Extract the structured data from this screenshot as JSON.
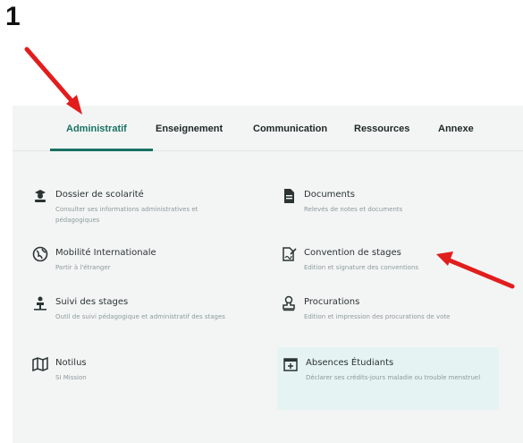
{
  "annotation": {
    "step_number": "1",
    "arrow_color": "#e21d1d"
  },
  "tabs": [
    {
      "label": "Administratif",
      "active": true
    },
    {
      "label": "Enseignement",
      "active": false
    },
    {
      "label": "Communication",
      "active": false
    },
    {
      "label": "Ressources",
      "active": false
    },
    {
      "label": "Annexe",
      "active": false
    }
  ],
  "colors": {
    "accent": "#187262",
    "panel_bg": "#f3f5f5",
    "highlight_bg": "#e6f3f3"
  },
  "items": [
    {
      "title": "Dossier de scolarité",
      "desc": "Consulter ses informations administratives et pédagogiques",
      "icon": "graduate-icon"
    },
    {
      "title": "Documents",
      "desc": "Relevés de notes et documents",
      "icon": "document-icon"
    },
    {
      "title": "Mobilité Internationale",
      "desc": "Partir à l'étranger",
      "icon": "globe-icon"
    },
    {
      "title": "Convention de stages",
      "desc": "Edition et signature des conventions",
      "icon": "sign-document-icon"
    },
    {
      "title": "Suivi des stages",
      "desc": "Outil de suivi pédagogique et administratif des stages",
      "icon": "presenter-icon"
    },
    {
      "title": "Procurations",
      "desc": "Edition et impression des procurations de vote",
      "icon": "stamp-icon"
    },
    {
      "title": "Notilus",
      "desc": "SI Mission",
      "icon": "map-icon"
    },
    {
      "title": "Absences Étudiants",
      "desc": "Déclarer ses crédits-jours maladie ou trouble menstruel",
      "icon": "calendar-plus-icon"
    }
  ]
}
